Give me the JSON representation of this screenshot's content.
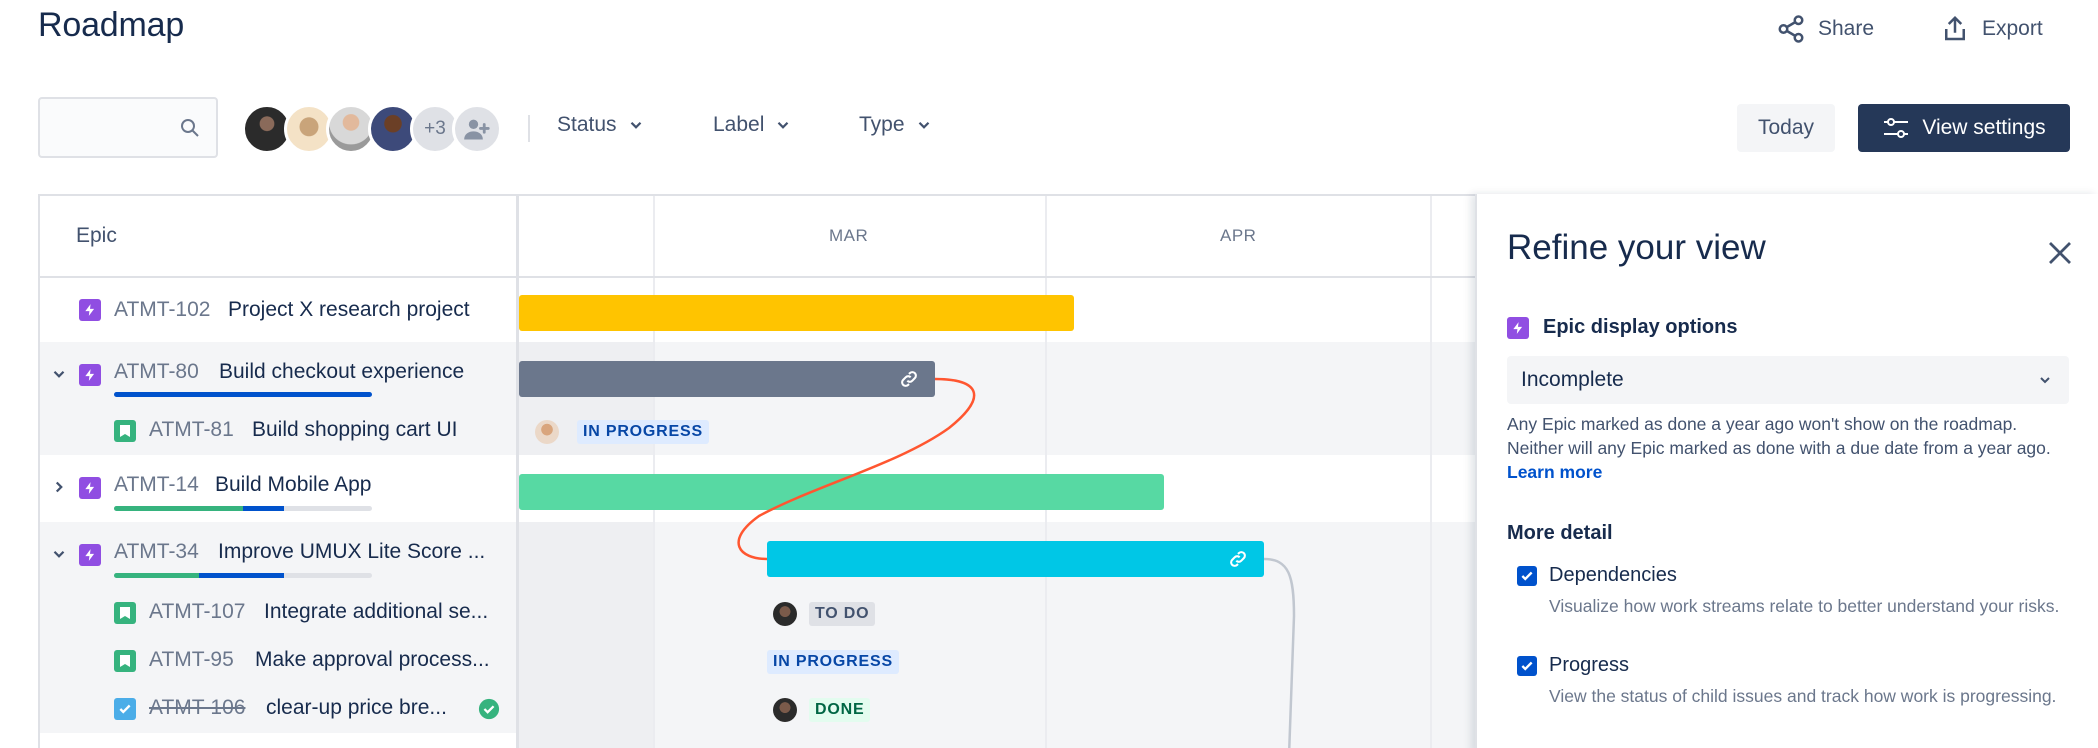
{
  "header": {
    "title": "Roadmap",
    "share_label": "Share",
    "export_label": "Export"
  },
  "toolbar": {
    "search_placeholder": "",
    "avatars_more": "+3",
    "filters": [
      "Status",
      "Label",
      "Type"
    ],
    "today_label": "Today",
    "view_settings_label": "View settings"
  },
  "grid": {
    "epic_header": "Epic",
    "months": [
      "MAR",
      "APR"
    ],
    "rows": [
      {
        "key": "ATMT-102",
        "title": "Project X research project",
        "type": "epic",
        "expand": "none",
        "status": ""
      },
      {
        "key": "ATMT-80",
        "title": "Build checkout experience",
        "type": "epic",
        "expand": "expanded",
        "progress": {
          "done": 0,
          "in_progress": 1.0,
          "todo": 0
        }
      },
      {
        "key": "ATMT-81",
        "title": "Build shopping cart UI",
        "type": "story",
        "status": "IN PROGRESS"
      },
      {
        "key": "ATMT-14",
        "title": "Build Mobile App",
        "type": "epic",
        "expand": "collapsed",
        "progress": {
          "done": 0.5,
          "in_progress": 0.16,
          "todo": 0.34
        }
      },
      {
        "key": "ATMT-34",
        "title": "Improve UMUX Lite Score ...",
        "type": "epic",
        "expand": "expanded",
        "progress": {
          "done": 0.33,
          "in_progress": 0.33,
          "todo": 0.34
        }
      },
      {
        "key": "ATMT-107",
        "title": "Integrate additional se...",
        "type": "story",
        "status": "TO DO"
      },
      {
        "key": "ATMT-95",
        "title": "Make approval process...",
        "type": "story",
        "status": "IN PROGRESS"
      },
      {
        "key": "ATMT-106",
        "title": "clear-up price bre...",
        "type": "task",
        "status": "DONE",
        "done": true
      }
    ]
  },
  "panel": {
    "title": "Refine your view",
    "epic_section": "Epic display options",
    "epic_select_value": "Incomplete",
    "help_text": "Any Epic marked as done a year ago won't show on the roadmap. Neither will any Epic marked as done with a due date from a year ago.",
    "learn_more": "Learn more",
    "more_detail": "More detail",
    "options": [
      {
        "label": "Dependencies",
        "description": "Visualize how work streams relate to better understand your risks.",
        "checked": true
      },
      {
        "label": "Progress",
        "description": "View the status of child issues and track how work is progressing.",
        "checked": true
      }
    ]
  },
  "colors": {
    "epic_yellow": "#ffc400",
    "epic_gray": "#6b778c",
    "epic_green": "#57d9a3",
    "epic_cyan": "#00c7e6",
    "dependency_red": "#ff5630",
    "brand_dark": "#253858"
  }
}
